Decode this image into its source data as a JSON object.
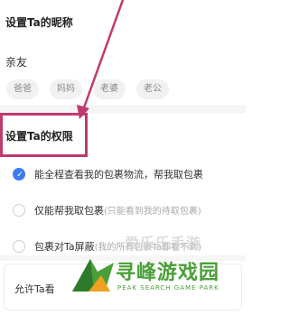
{
  "nickname": {
    "title": "设置Ta的昵称",
    "value": "亲友",
    "chips": [
      "爸爸",
      "妈妈",
      "老婆",
      "老公"
    ]
  },
  "permissions": {
    "title": "设置Ta的权限",
    "options": [
      {
        "main": "能全程查看我的包裹物流，帮我取包裹",
        "sub": "",
        "checked": true
      },
      {
        "main": "仅能帮我取包裹",
        "sub": "(只能看到我的待取包裹)",
        "checked": false
      },
      {
        "main": "包裹对Ta屏蔽",
        "sub": "(我的所有包裹Ta都看不到)",
        "checked": false
      }
    ]
  },
  "allow": {
    "text": "允许Ta看"
  },
  "watermark": {
    "faint": "爱乐乐手游",
    "main": "寻峰游戏园",
    "sub": "PEAK SEARCH GAME PARK"
  },
  "colors": {
    "accent": "#3d7cf0",
    "highlight": "#c0396f",
    "watermark": "#4aa038"
  }
}
